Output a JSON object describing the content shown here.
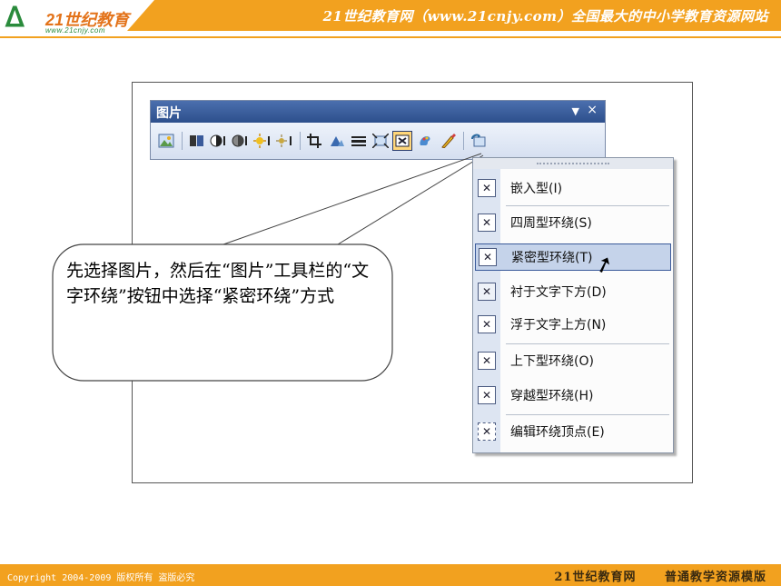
{
  "header": {
    "logo_text": "21世纪教育",
    "logo_url": "www.21cnjy.com",
    "title": "21世纪教育网（www.21cnjy.com）全国最大的中小学教育资源网站"
  },
  "toolbar": {
    "title": "图片",
    "dropdown_glyph": "▼",
    "close_glyph": "×"
  },
  "wrap_menu": {
    "items": [
      {
        "label": "嵌入型(I)",
        "icon": "inline-wrap-icon"
      },
      {
        "label": "四周型环绕(S)",
        "icon": "square-wrap-icon"
      },
      {
        "label": "紧密型环绕(T)",
        "icon": "tight-wrap-icon"
      },
      {
        "label": "衬于文字下方(D)",
        "icon": "behind-text-icon"
      },
      {
        "label": "浮于文字上方(N)",
        "icon": "in-front-text-icon"
      },
      {
        "label": "上下型环绕(O)",
        "icon": "top-bottom-wrap-icon"
      },
      {
        "label": "穿越型环绕(H)",
        "icon": "through-wrap-icon"
      },
      {
        "label": "编辑环绕顶点(E)",
        "icon": "edit-wrap-points-icon"
      }
    ],
    "highlighted_index": 2
  },
  "callout": {
    "text": "先选择图片，然后在“图片”工具栏的“文字环绕”按钮中选择“紧密环绕”方式"
  },
  "footer": {
    "copyright": "Copyright 2004-2009 版权所有 盗版必究",
    "site": "21世纪教育网",
    "tagline": "普通教学资源模版"
  },
  "colors": {
    "accent": "#f2a11f",
    "toolbar_title": "#2d4f8c",
    "menu_highlight": "#c5d3ea"
  }
}
